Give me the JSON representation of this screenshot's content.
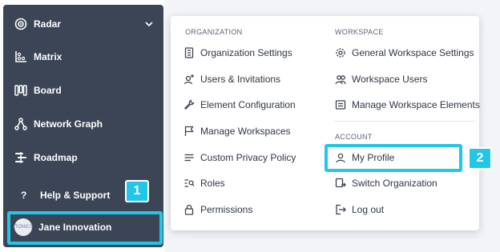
{
  "sidebar": {
    "items": [
      {
        "label": "Radar",
        "icon": "radar-icon"
      },
      {
        "label": "Matrix",
        "icon": "matrix-icon"
      },
      {
        "label": "Board",
        "icon": "board-icon"
      },
      {
        "label": "Network Graph",
        "icon": "network-graph-icon"
      },
      {
        "label": "Roadmap",
        "icon": "roadmap-icon"
      }
    ],
    "help_label": "Help & Support",
    "help_glyph": "?",
    "user_name": "Jane Innovation",
    "avatar_text": "ITONICS"
  },
  "menu": {
    "organization_heading": "ORGANIZATION",
    "organization_items": [
      {
        "label": "Organization Settings",
        "icon": "building-icon"
      },
      {
        "label": "Users & Invitations",
        "icon": "user-plus-icon"
      },
      {
        "label": "Element Configuration",
        "icon": "wrench-icon"
      },
      {
        "label": "Manage Workspaces",
        "icon": "flag-icon"
      },
      {
        "label": "Custom Privacy Policy",
        "icon": "lines-icon"
      },
      {
        "label": "Roles",
        "icon": "roles-icon"
      },
      {
        "label": "Permissions",
        "icon": "lock-icon"
      }
    ],
    "workspace_heading": "WORKSPACE",
    "workspace_items": [
      {
        "label": "General Workspace Settings",
        "icon": "gear-icon"
      },
      {
        "label": "Workspace Users",
        "icon": "users-icon"
      },
      {
        "label": "Manage Workspace Elements",
        "icon": "list-box-icon"
      }
    ],
    "account_heading": "ACCOUNT",
    "account_items": [
      {
        "label": "My Profile",
        "icon": "user-icon"
      },
      {
        "label": "Switch Organization",
        "icon": "switch-icon"
      },
      {
        "label": "Log out",
        "icon": "logout-icon"
      }
    ]
  },
  "annotations": {
    "badge_1": "1",
    "badge_2": "2",
    "highlight_color": "#22c6e8"
  },
  "colors": {
    "sidebar_bg": "#3b4556",
    "accent": "#22c6e8"
  }
}
